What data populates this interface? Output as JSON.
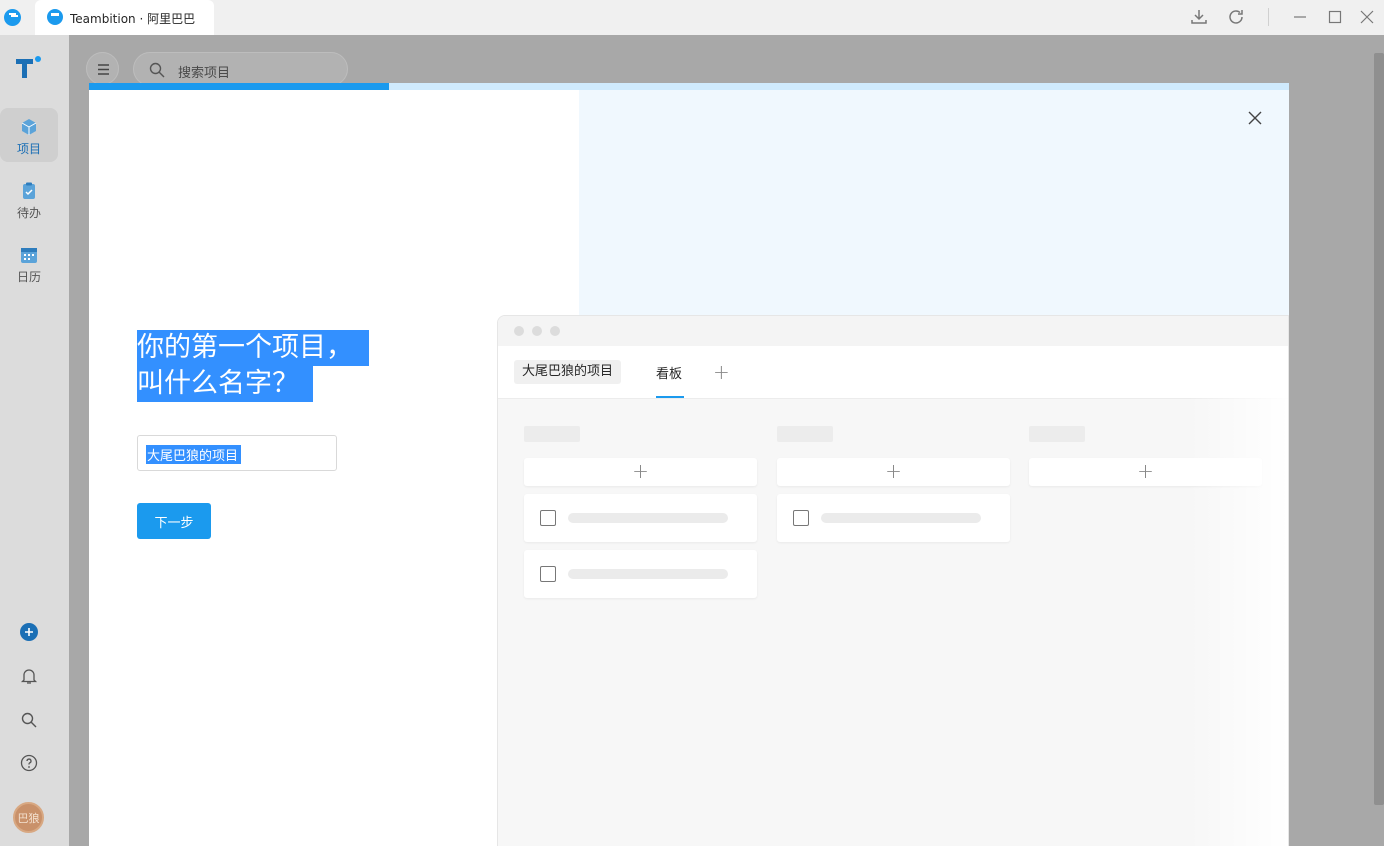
{
  "window": {
    "tab_title": "Teambition · 阿里巴巴",
    "accent": "#1b9aee"
  },
  "sidebar": {
    "items": [
      {
        "label": "项目",
        "icon": "cube-icon",
        "active": true
      },
      {
        "label": "待办",
        "icon": "clipboard-icon",
        "active": false
      },
      {
        "label": "日历",
        "icon": "calendar-icon",
        "active": false
      }
    ],
    "bottom_icons": [
      "add-icon",
      "bell-icon",
      "search-icon",
      "help-icon"
    ],
    "avatar_text": "巴狼"
  },
  "header": {
    "search_placeholder": "搜索项目"
  },
  "modal": {
    "progress": 0.25,
    "heading_line1": "你的第一个项目，",
    "heading_line2": "叫什么名字？",
    "input_value": "大尾巴狼的项目",
    "next_label": "下一步"
  },
  "preview": {
    "project_tab": "大尾巴狼的项目",
    "board_tab": "看板",
    "plus": "+",
    "add_symbol": "+"
  }
}
